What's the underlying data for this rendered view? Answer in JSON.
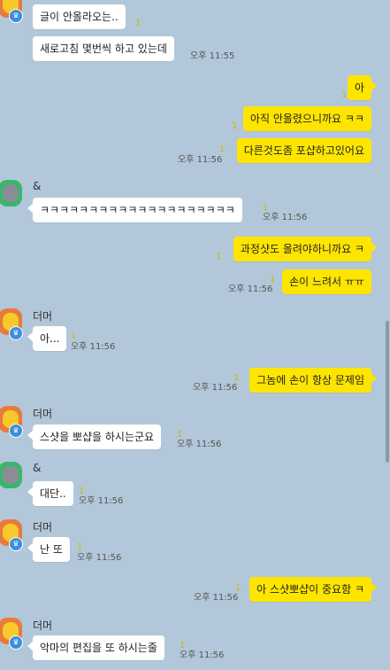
{
  "colors": {
    "background": "#b2c7d9",
    "my_bubble": "#fee500",
    "their_bubble": "#ffffff",
    "unread": "#d4b800"
  },
  "messages": [
    {
      "text": "글이 안올라오는..",
      "unread": "1"
    },
    {
      "text": "새로고침 몇번씩 하고 있는데",
      "time": "오후 11:55"
    },
    {
      "text": "아",
      "unread": "1"
    },
    {
      "text": "아직 안올렸으니까요 ㅋㅋ",
      "unread": "1"
    },
    {
      "text": "다른것도좀 포샵하고있어요",
      "unread": "1",
      "time": "오후 11:56"
    },
    {
      "sender": "&",
      "text": "ㅋㅋㅋㅋㅋㅋㅋㅋㅋㅋㅋㅋㅋㅋㅋㅋㅋㅋㅋㅋ",
      "unread": "1",
      "time": "오후 11:56"
    },
    {
      "text": "과정샷도 올려야하니까요 ㅋ",
      "unread": "1"
    },
    {
      "text": "손이 느려서 ㅠㅠ",
      "unread": "1",
      "time": "오후 11:56"
    },
    {
      "sender": "더머",
      "text": "아...",
      "unread": "1",
      "time": "오후 11:56"
    },
    {
      "text": "그놈에 손이 항상 문제임",
      "unread": "1",
      "time": "오후 11:56"
    },
    {
      "sender": "더머",
      "text": "스샷을 뽀샵을 하시는군요",
      "unread": "1",
      "time": "오후 11:56"
    },
    {
      "sender": "&",
      "text": "대단..",
      "unread": "1",
      "time": "오후 11:56"
    },
    {
      "sender": "더머",
      "text": "난 또",
      "unread": "1",
      "time": "오후 11:56"
    },
    {
      "text": "아 스샷뽀샵이 중요함 ㅋ",
      "unread": "1",
      "time": "오후 11:56"
    },
    {
      "sender": "더머",
      "text": "악마의 편집을 또 하시는줄",
      "unread": "1",
      "time": "오후 11:56"
    }
  ]
}
